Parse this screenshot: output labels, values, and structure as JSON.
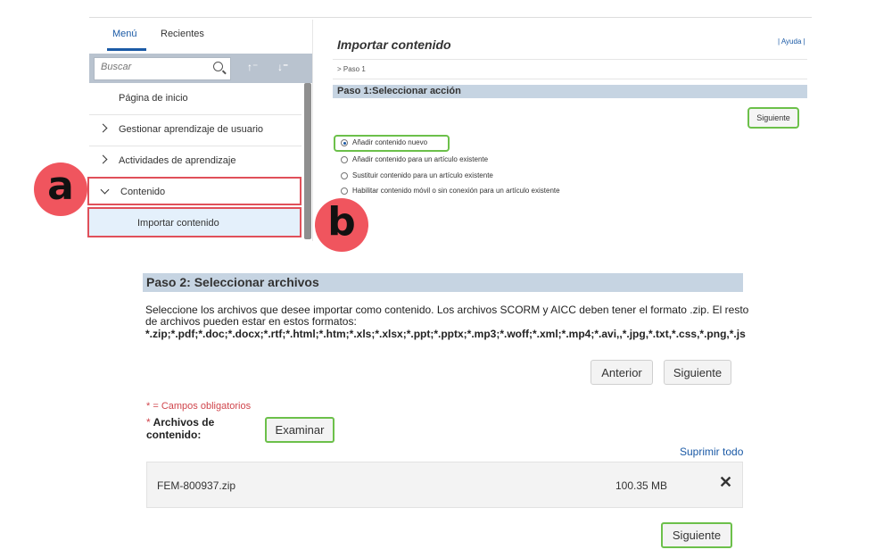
{
  "sidebar": {
    "tabs": [
      {
        "label": "Menú"
      },
      {
        "label": "Recientes"
      }
    ],
    "search": {
      "placeholder": "Buscar"
    },
    "items": [
      {
        "label": "Página de inicio"
      },
      {
        "label": "Gestionar aprendizaje de usuario"
      },
      {
        "label": "Actividades de aprendizaje"
      },
      {
        "label": "Contenido"
      },
      {
        "label": "Importar contenido"
      }
    ]
  },
  "annotations": {
    "a": "a",
    "b": "b"
  },
  "step1": {
    "title": "Importar contenido",
    "help": "Ayuda",
    "breadcrumb": "> Paso 1",
    "header": "Paso 1:Seleccionar acción",
    "next_label": "Siguiente",
    "options": [
      {
        "label": "Añadir contenido nuevo",
        "selected": true
      },
      {
        "label": "Añadir contenido para un artículo existente",
        "selected": false
      },
      {
        "label": "Sustituir contenido para un artículo existente",
        "selected": false
      },
      {
        "label": "Habilitar contenido móvil o sin conexión para un artículo existente",
        "selected": false
      }
    ]
  },
  "step2": {
    "header": "Paso 2: Seleccionar archivos",
    "description": "Seleccione los archivos que desee importar como contenido. Los archivos SCORM y AICC deben tener el formato .zip. El resto de archivos pueden estar en estos formatos:",
    "formats": "*.zip;*.pdf;*.doc;*.docx;*.rtf;*.html;*.htm;*.xls;*.xlsx;*.ppt;*.pptx;*.mp3;*.woff;*.xml;*.mp4;*.avi,,*.jpg,*.txt,*.css,*.png,*.js",
    "prev_label": "Anterior",
    "next_label": "Siguiente",
    "required_note": "* = Campos obligatorios",
    "field_star": "*",
    "field_label": "Archivos de contenido:",
    "browse_label": "Examinar",
    "delete_all": "Suprimir todo",
    "file": {
      "name": "FEM-800937.zip",
      "size": "100.35 MB",
      "remove": "✕"
    },
    "bottom_next_label": "Siguiente"
  },
  "colors": {
    "accent": "#1b5aa6",
    "highlight_green": "#6cc04a",
    "highlight_red": "#e0505a",
    "badge": "#f0555e",
    "step_bar": "#c6d4e2"
  }
}
